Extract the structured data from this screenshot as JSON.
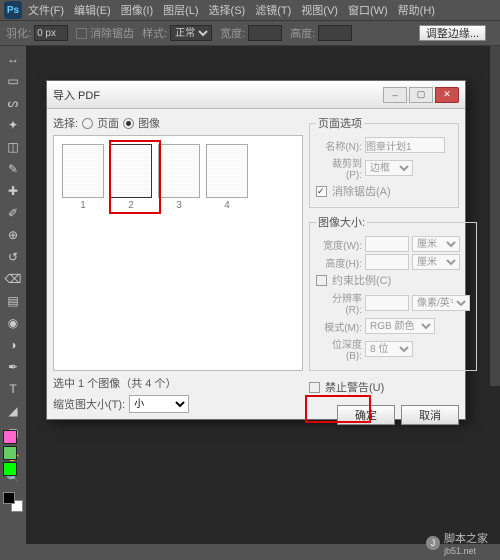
{
  "menu": {
    "items": [
      "文件(F)",
      "编辑(E)",
      "图像(I)",
      "图层(L)",
      "选择(S)",
      "滤镜(T)",
      "视图(V)",
      "窗口(W)",
      "帮助(H)"
    ]
  },
  "optbar": {
    "feather_label": "羽化:",
    "feather_val": "0 px",
    "antialias": "消除锯齿",
    "style_label": "样式:",
    "style_val": "正常",
    "width_label": "宽度:",
    "height_label": "高度:",
    "refine": "调整边缘..."
  },
  "tools": [
    "▭",
    "▦",
    "◫",
    "⬚",
    "✂",
    "✎",
    "✥",
    "↺",
    "✐",
    "⌫",
    "◉",
    "▤",
    "T",
    "◢",
    "✋",
    "🔍"
  ],
  "dialog": {
    "title": "导入 PDF",
    "select_label": "选择:",
    "radio_page": "页面",
    "radio_image": "图像",
    "pages": [
      "1",
      "2",
      "3",
      "4"
    ],
    "status": "选中 1 个图像（共 4 个）",
    "thumb_label": "缩览图大小(T):",
    "thumb_val": "小",
    "grp_page": "页面选项",
    "name_label": "名称(N):",
    "name_val": "图章计划1",
    "crop_label": "裁剪到(P):",
    "crop_val": "边框",
    "antialias_chk": "消除锯齿(A)",
    "grp_size": "图像大小:",
    "width_label": "宽度(W):",
    "height_label": "高度(H):",
    "constrain": "约束比例(C)",
    "unit_cm": "厘米",
    "res_label": "分辨率(R):",
    "res_unit": "像素/英寸",
    "mode_label": "模式(M):",
    "mode_val": "RGB 颜色",
    "depth_label": "位深度(B):",
    "depth_val": "8 位",
    "suppress": "禁止警告(U)",
    "ok": "确定",
    "cancel": "取消"
  },
  "watermark": {
    "text": "脚本之家",
    "url": "jb51.net"
  },
  "swatches": [
    "#ff66cc",
    "#66cc66",
    "#00ff00"
  ]
}
